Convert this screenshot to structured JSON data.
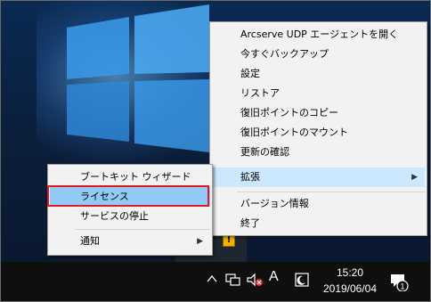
{
  "main_menu": {
    "items": [
      {
        "label": "Arcserve UDP エージェントを開く"
      },
      {
        "label": "今すぐバックアップ"
      },
      {
        "label": "設定"
      },
      {
        "label": "リストア"
      },
      {
        "label": "復旧ポイントのコピー"
      },
      {
        "label": "復旧ポイントのマウント"
      },
      {
        "label": "更新の確認"
      },
      {
        "label": "拡張"
      },
      {
        "label": "バージョン情報"
      },
      {
        "label": "終了"
      }
    ]
  },
  "sub_menu": {
    "items": [
      {
        "label": "ブートキット ウィザード"
      },
      {
        "label": "ライセンス"
      },
      {
        "label": "サービスの停止"
      },
      {
        "label": "通知"
      }
    ]
  },
  "taskbar": {
    "ime_label": "A",
    "time": "15:20",
    "date": "2019/06/04",
    "notification_count": "1"
  },
  "colors": {
    "highlight": "#91c9f7",
    "selection_outline": "#e01b22",
    "menu_background": "#f2f2f2",
    "taskbar": "#0f0f0f"
  }
}
